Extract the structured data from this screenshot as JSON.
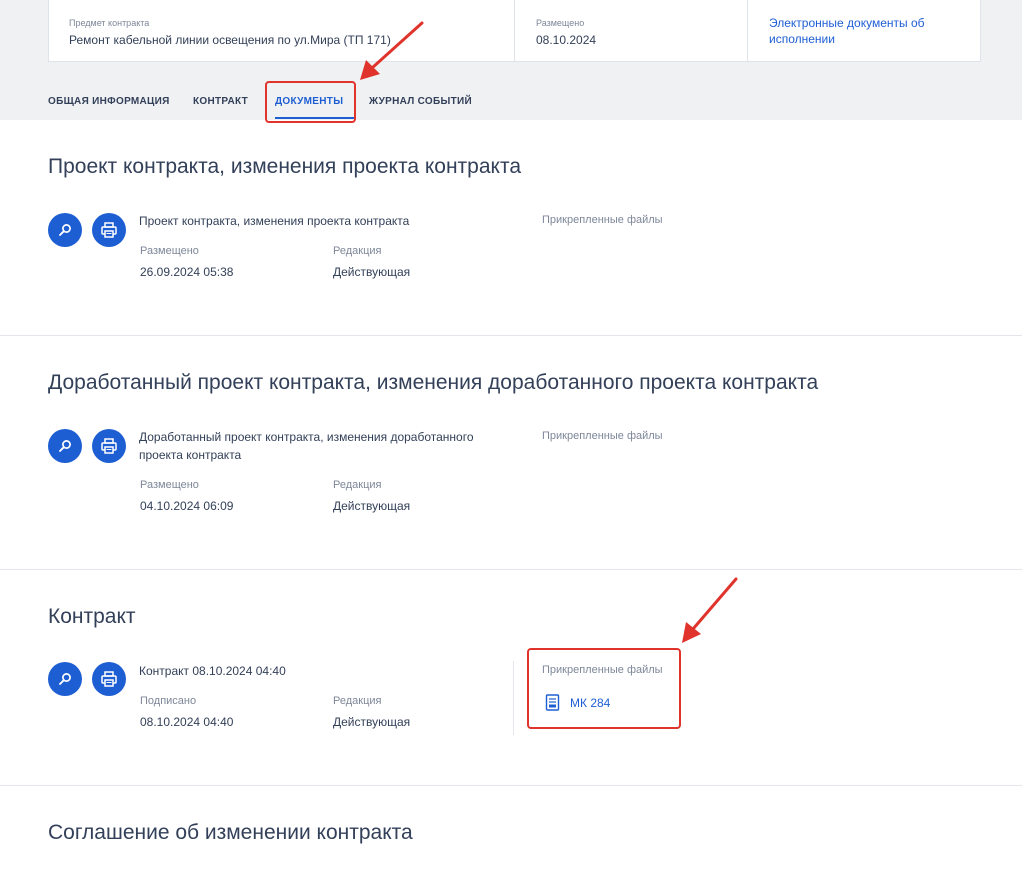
{
  "contract_info": {
    "subject_label": "Предмет контракта",
    "subject_value": "Ремонт кабельной линии освещения по ул.Мира (ТП 171)",
    "posted_label": "Размещено",
    "posted_value": "08.10.2024",
    "edocs_link": "Электронные документы об исполнении"
  },
  "tabs": [
    {
      "label": "ОБЩАЯ ИНФОРМАЦИЯ",
      "active": false
    },
    {
      "label": "КОНТРАКТ",
      "active": false
    },
    {
      "label": "ДОКУМЕНТЫ",
      "active": true
    },
    {
      "label": "ЖУРНАЛ СОБЫТИЙ",
      "active": false
    }
  ],
  "sections": [
    {
      "title": "Проект контракта, изменения проекта контракта",
      "doc_name": "Проект контракта, изменения проекта контракта",
      "date_label": "Размещено",
      "date_value": "26.09.2024 05:38",
      "edition_label": "Редакция",
      "edition_value": "Действующая",
      "files_label": "Прикрепленные файлы",
      "files": []
    },
    {
      "title": "Доработанный проект контракта, изменения доработанного проекта контракта",
      "doc_name": "Доработанный проект контракта, изменения доработанного проекта контракта",
      "date_label": "Размещено",
      "date_value": "04.10.2024 06:09",
      "edition_label": "Редакция",
      "edition_value": "Действующая",
      "files_label": "Прикрепленные файлы",
      "files": []
    },
    {
      "title": "Контракт",
      "doc_name": "Контракт 08.10.2024 04:40",
      "date_label": "Подписано",
      "date_value": "08.10.2024 04:40",
      "edition_label": "Редакция",
      "edition_value": "Действующая",
      "files_label": "Прикрепленные файлы",
      "files": [
        {
          "name": "МК 284",
          "icon": "document-icon"
        }
      ]
    },
    {
      "title": "Соглашение об изменении контракта"
    }
  ],
  "icons": {
    "view": "magnifier-icon",
    "print": "printer-icon"
  },
  "colors": {
    "accent": "#1e5ed3",
    "annotation": "#e0332c",
    "top_background": "#f0f1f3"
  }
}
